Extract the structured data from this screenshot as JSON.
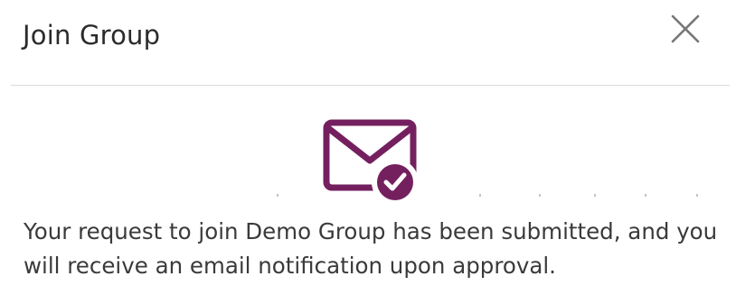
{
  "dialog": {
    "title": "Join Group",
    "close_icon": "close-icon",
    "status_icon": "mail-check-icon",
    "message": "Your request to join Demo Group has been submitted, and you will receive an email notification upon approval."
  },
  "colors": {
    "icon_accent": "#74205f",
    "title_text": "#2b2b2b",
    "body_text": "#3a3a3a",
    "divider": "#dcdcdc",
    "close_icon": "#777777"
  }
}
